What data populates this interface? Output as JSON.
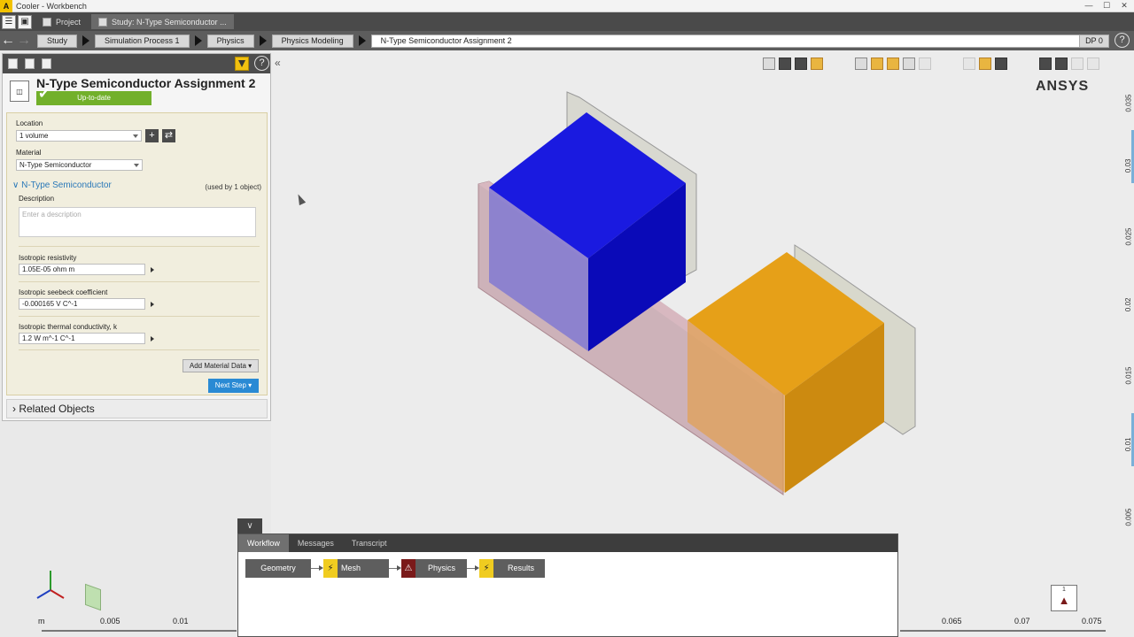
{
  "window": {
    "title": "Cooler - Workbench",
    "logo": "A"
  },
  "tabs": [
    {
      "label": "Project",
      "active": false
    },
    {
      "label": "Study: N-Type Semiconductor ...",
      "active": true
    }
  ],
  "breadcrumbs": [
    "Study",
    "Simulation Process 1",
    "Physics",
    "Physics Modeling",
    "N-Type Semiconductor Assignment 2"
  ],
  "dp": "DP 0",
  "panel": {
    "title": "N-Type Semiconductor Assignment 2",
    "status": "Up-to-date",
    "location_label": "Location",
    "location_value": "1 volume",
    "material_label": "Material",
    "material_value": "N-Type Semiconductor",
    "section_title": "N-Type Semiconductor",
    "used_by": "(used by 1 object)",
    "description_label": "Description",
    "description_placeholder": "Enter a description",
    "props": [
      {
        "label": "Isotropic resistivity",
        "value": "1.05E-05 ohm m"
      },
      {
        "label": "Isotropic seebeck coefficient",
        "value": "-0.000165 V C^-1"
      },
      {
        "label": "Isotropic thermal conductivity, k",
        "value": "1.2 W m^-1 C^-1"
      }
    ],
    "add_button": "Add Material Data",
    "next_button": "Next Step",
    "related": "Related Objects"
  },
  "viewport": {
    "brand": "ANSYS",
    "right_scale": [
      "0.035",
      "0.03",
      "0.025",
      "0.02",
      "0.015",
      "0.01",
      "0.005"
    ],
    "bottom_scale": [
      "m",
      "0.005",
      "0.01",
      "0.065",
      "0.07",
      "0.075"
    ],
    "colors": {
      "blue": "#1a1adb",
      "orange": "#e8a020",
      "pink": "#c8a0a8",
      "plate": "#d6d6cc"
    }
  },
  "workflow": {
    "tabs": [
      "Workflow",
      "Messages",
      "Transcript"
    ],
    "nodes": [
      {
        "label": "Geometry",
        "badge": ""
      },
      {
        "label": "Mesh",
        "badge": "lightning"
      },
      {
        "label": "Physics",
        "badge": "warning"
      },
      {
        "label": "Results",
        "badge": "lightning"
      }
    ]
  },
  "warning_count": "1",
  "icons": [
    "filter-icon",
    "help-icon",
    "back-arrow-icon",
    "forward-arrow-icon",
    "plus-icon",
    "swap-icon",
    "warning-icon",
    "lightning-icon",
    "triad-icon"
  ]
}
